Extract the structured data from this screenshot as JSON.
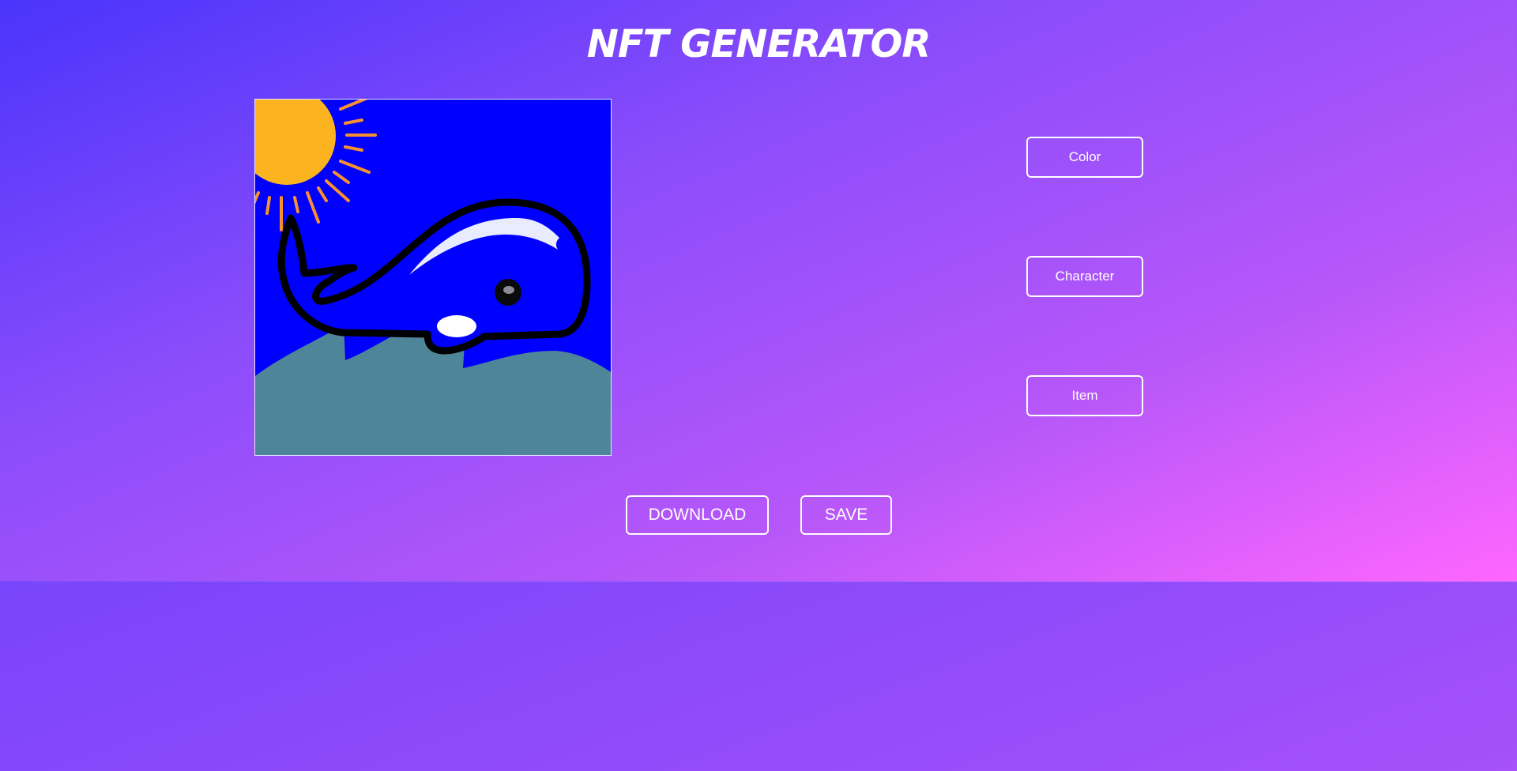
{
  "header": {
    "title": "NFT GENERATOR"
  },
  "preview": {
    "background_color": "#0000ff",
    "sun_color": "#fbb41f",
    "ray_color": "#f7902f",
    "wave_color": "#4f8598",
    "whale_color": "#0000ff"
  },
  "options": {
    "color_label": "Color",
    "character_label": "Character",
    "item_label": "Item"
  },
  "actions": {
    "download_label": "DOWNLOAD",
    "save_label": "SAVE"
  }
}
